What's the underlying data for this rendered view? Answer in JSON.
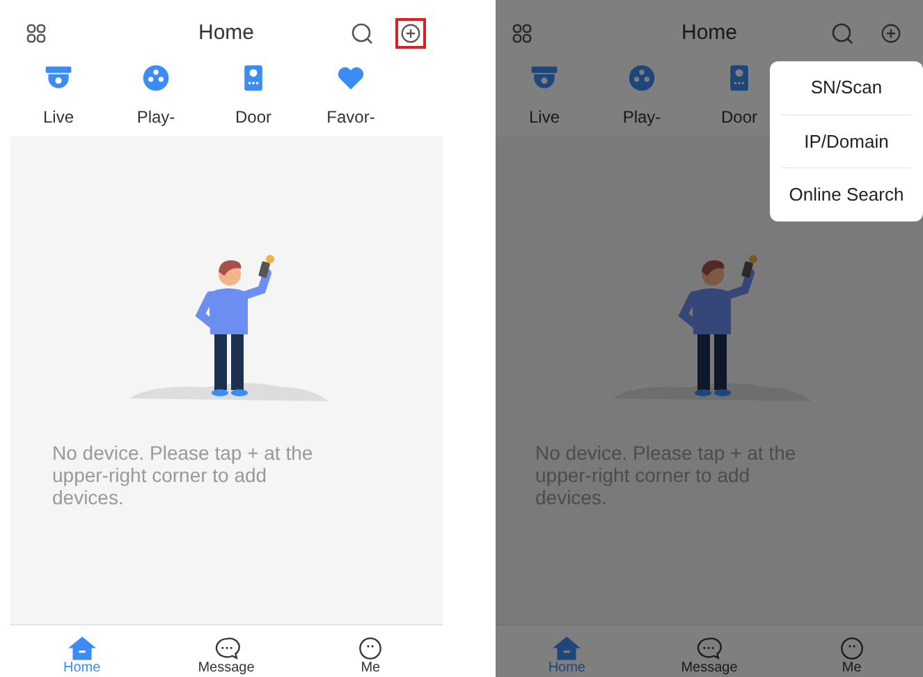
{
  "screens": [
    {
      "title": "Home",
      "dimmed": false,
      "add_highlighted": true,
      "shortcuts": [
        {
          "kind": "camera",
          "label": "Live"
        },
        {
          "kind": "playback",
          "label": "Play-"
        },
        {
          "kind": "door",
          "label": "Door"
        },
        {
          "kind": "favorite",
          "label": "Favor-"
        }
      ],
      "empty_message": "No device. Please tap + at the upper-right corner to add devices.",
      "nav": [
        {
          "kind": "home",
          "label": "Home",
          "selected": true
        },
        {
          "kind": "message",
          "label": "Message",
          "selected": false
        },
        {
          "kind": "me",
          "label": "Me",
          "selected": false
        }
      ]
    },
    {
      "title": "Home",
      "dimmed": true,
      "add_highlighted": false,
      "shortcuts": [
        {
          "kind": "camera",
          "label": "Live"
        },
        {
          "kind": "playback",
          "label": "Play-"
        },
        {
          "kind": "door",
          "label": "Door"
        }
      ],
      "empty_message": "No device. Please tap + at the upper-right corner to add devices.",
      "nav": [
        {
          "kind": "home",
          "label": "Home",
          "selected": true
        },
        {
          "kind": "message",
          "label": "Message",
          "selected": false
        },
        {
          "kind": "me",
          "label": "Me",
          "selected": false
        }
      ],
      "menu": [
        "SN/Scan",
        "IP/Domain",
        "Online Search"
      ]
    }
  ]
}
